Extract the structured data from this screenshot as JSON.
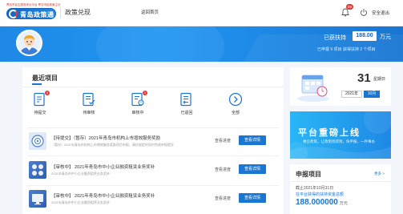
{
  "header": {
    "logo_tagline": "青岛市民生服务综合平台 青岛市民政局主办",
    "logo_text": "青岛政策通",
    "site_title": "政策兑现",
    "home_link": "返回首页",
    "notification_count": "99",
    "logout_label": "安全退出"
  },
  "banner": {
    "supported_label": "已获扶持",
    "amount": "188.00",
    "amount_unit": "万元",
    "stats_text": "已申报 9 项目   获得扶持 2 个项目"
  },
  "recent": {
    "title": "最近项目",
    "statuses": [
      {
        "label": "待提交",
        "icon": "document-edit-icon",
        "badge": "2"
      },
      {
        "label": "待审核",
        "icon": "document-check-icon",
        "badge": ""
      },
      {
        "label": "审核中",
        "icon": "document-lock-icon",
        "badge": "1"
      },
      {
        "label": "已退回",
        "icon": "document-return-icon",
        "badge": ""
      },
      {
        "label": "全部",
        "icon": "chevron-right-icon",
        "badge": ""
      }
    ],
    "projects": [
      {
        "title": "【待提交】（暂存）2021年青岛市机构上市增效服务奖励",
        "sub": "（暂存）2021年青岛市机构上市增效服务奖励项目申报，请在规定时间内完成申报提交",
        "progress": "查看进度",
        "detail": "查看详情"
      },
      {
        "title": "【审核中】          2021年青岛市中小企业融资租赁业务奖补",
        "sub": "2021年青岛市中小企业融资租赁业务奖补",
        "progress": "查看进度",
        "detail": "查看详情"
      },
      {
        "title": "【审核中】          2021年青岛市中小企业融资租赁业务奖补",
        "sub": "2021年青岛市中小企业融资租赁业务奖补",
        "progress": "查看进度",
        "detail": "查看详情"
      }
    ]
  },
  "calendar": {
    "day": "31",
    "weekday": "星期日",
    "year": "2021年",
    "month": "10月"
  },
  "promo": {
    "title": "平台重磅上线",
    "subtitle": "惠企政策，让政策找得到，快申报，一件事办"
  },
  "apply": {
    "title": "申报项目",
    "more": "更多 >",
    "date_text": "截止2021年10月31日",
    "desc": "在平台获得的扶持资金总额",
    "amount": "188.000000",
    "unit": "万元"
  },
  "colors": {
    "primary": "#1976d2",
    "banner": "#2196f3",
    "badge": "#e53935"
  }
}
